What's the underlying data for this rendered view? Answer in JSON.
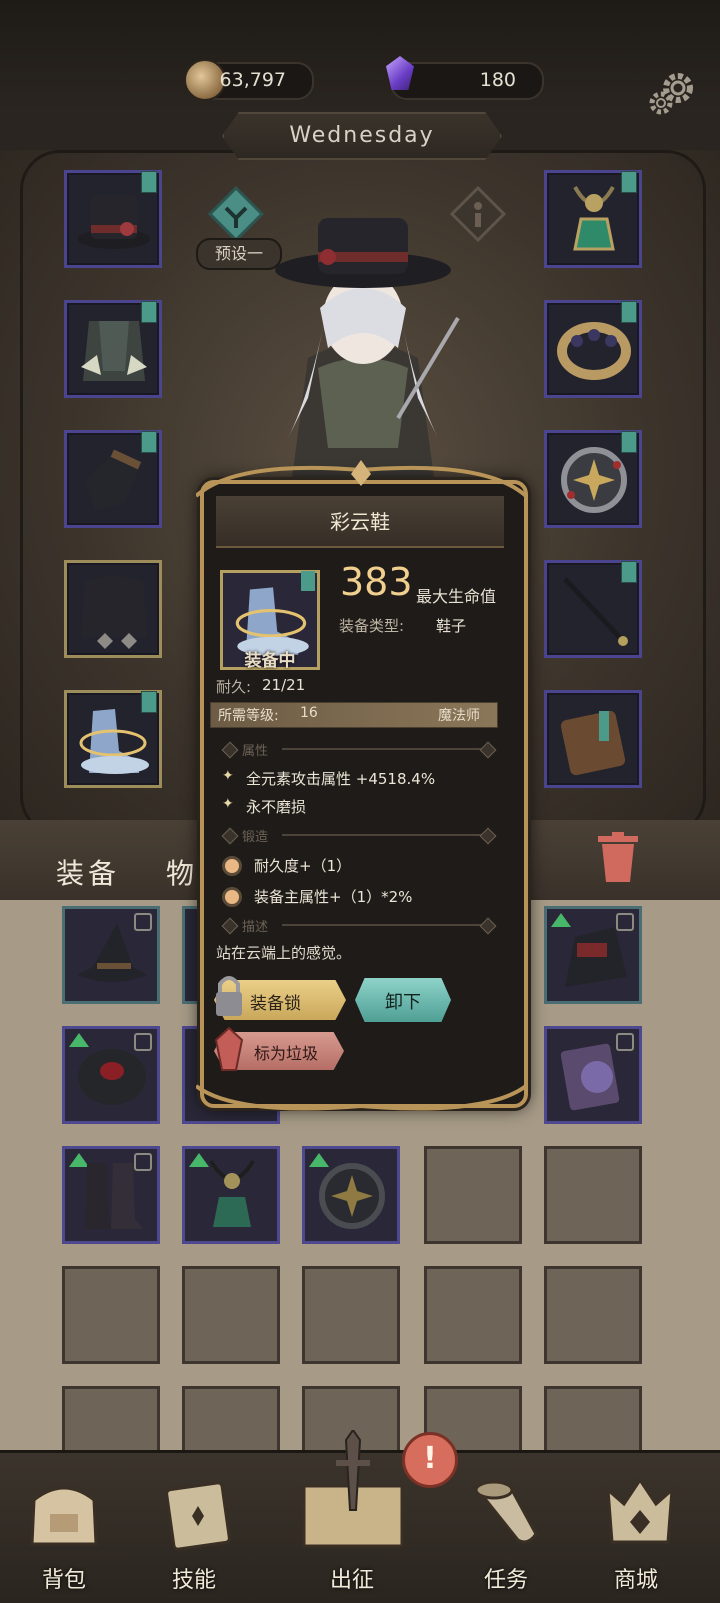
{
  "currency": {
    "gold": "63,797",
    "gems": "180"
  },
  "day": "Wednesday",
  "preset": {
    "label": "预设一"
  },
  "inventory_tabs": {
    "equipment": "装备",
    "items": "物"
  },
  "popup": {
    "title": "彩云鞋",
    "equipped_label": "装备中",
    "stat_value": "383",
    "stat_name": "最大生命值",
    "type_label": "装备类型:",
    "type_value": "鞋子",
    "durability_label": "耐久:",
    "durability_value": "21/21",
    "level_label": "所需等级:",
    "level_value": "16",
    "class_value": "魔法师",
    "section_attributes": "属性",
    "attributes": [
      "全元素攻击属性 +4518.4%",
      "永不磨损"
    ],
    "section_forge": "锻造",
    "forge": [
      "耐久度+（1）",
      "装备主属性+（1）*2%"
    ],
    "section_desc": "描述",
    "description": "站在云端上的感觉。",
    "btn_lock": "装备锁",
    "btn_unequip": "卸下",
    "btn_junk": "标为垃圾"
  },
  "bottom_nav": {
    "bag": "背包",
    "skills": "技能",
    "battle": "出征",
    "quests": "任务",
    "shop": "商城"
  },
  "alert_badge": "!",
  "colors": {
    "accent_gold": "#b89459",
    "slot_border": "#4b4590",
    "unequip": "#6fbcb1",
    "lock": "#e3c478",
    "junk": "#cf8a80"
  }
}
